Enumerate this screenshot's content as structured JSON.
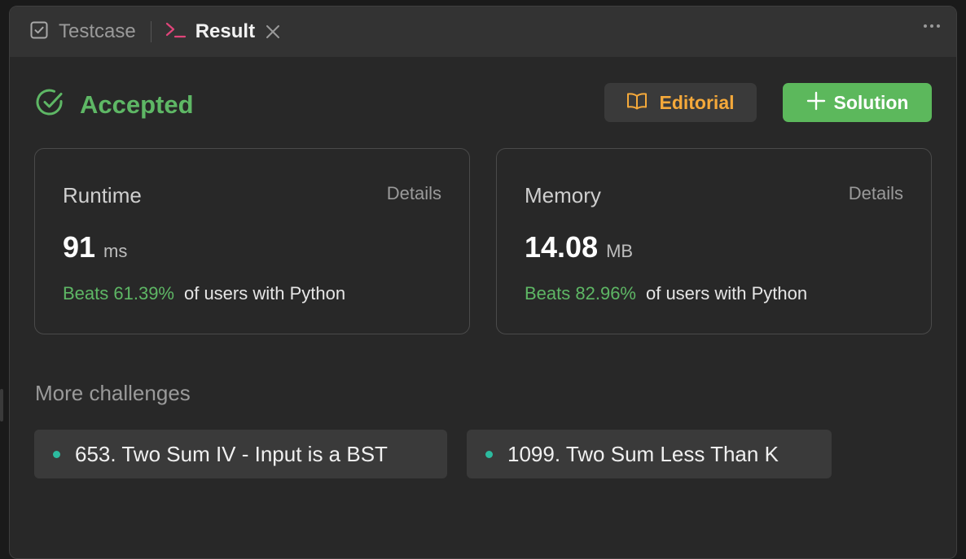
{
  "tabs": {
    "testcase_label": "Testcase",
    "result_label": "Result"
  },
  "status": {
    "text": "Accepted",
    "color": "#5eb765"
  },
  "actions": {
    "editorial_label": "Editorial",
    "solution_label": "Solution",
    "editorial_color": "#f5a93a",
    "solution_bg": "#5cb85c"
  },
  "runtime": {
    "title": "Runtime",
    "details_label": "Details",
    "value": "91",
    "unit": "ms",
    "beats": "Beats 61.39%",
    "rest": "of users with Python"
  },
  "memory": {
    "title": "Memory",
    "details_label": "Details",
    "value": "14.08",
    "unit": "MB",
    "beats": "Beats 82.96%",
    "rest": "of users with Python"
  },
  "more_challenges": {
    "title": "More challenges",
    "items": [
      {
        "label": "653. Two Sum IV - Input is a BST"
      },
      {
        "label": "1099. Two Sum Less Than K"
      }
    ]
  },
  "icons": {
    "testcase": "checkbox-icon",
    "result": "terminal-prompt-icon",
    "close": "close-icon",
    "more": "more-horizontal-icon",
    "status": "check-circle-icon",
    "editorial": "book-open-icon",
    "solution": "plus-icon"
  }
}
